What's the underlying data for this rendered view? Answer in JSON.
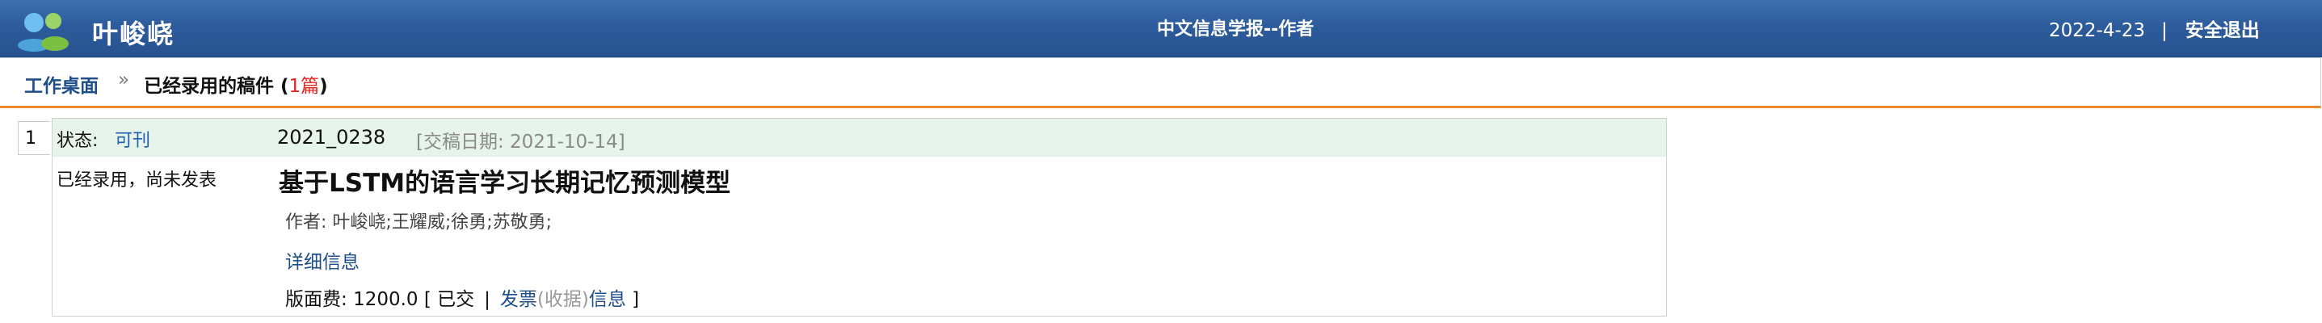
{
  "header": {
    "user_name": "叶峻峣",
    "site_title": "中文信息学报--作者",
    "date": "2022-4-23",
    "separator": "|",
    "logout_label": "安全退出",
    "avatar_icon": "users-icon",
    "bar_color": "#2d5c9c"
  },
  "breadcrumb": {
    "home_label": "工作桌面",
    "arrow": "»",
    "current_label": "已经录用的稿件",
    "count_open": "(",
    "count_text": "1篇",
    "count_close": ")",
    "accent_color": "#f08a2e"
  },
  "records": [
    {
      "index": "1",
      "status_label": "状态:",
      "status_value": "可刊",
      "manuscript_id": "2021_0238",
      "submit_date": "[交稿日期: 2021-10-14]",
      "accepted_note": "已经录用，尚未发表",
      "title": "基于LSTM的语言学习长期记忆预测模型",
      "authors": "作者: 叶峻峣;王耀威;徐勇;苏敬勇;",
      "detail_label": "详细信息",
      "fee_label": "版面费:",
      "fee_amount": "1200.0",
      "fee_open": "[",
      "fee_paid": "已交",
      "fee_pipe": "|",
      "invoice_part1": "发票",
      "invoice_part2": "(收据)",
      "invoice_part3": "信息",
      "fee_close": "]"
    }
  ]
}
